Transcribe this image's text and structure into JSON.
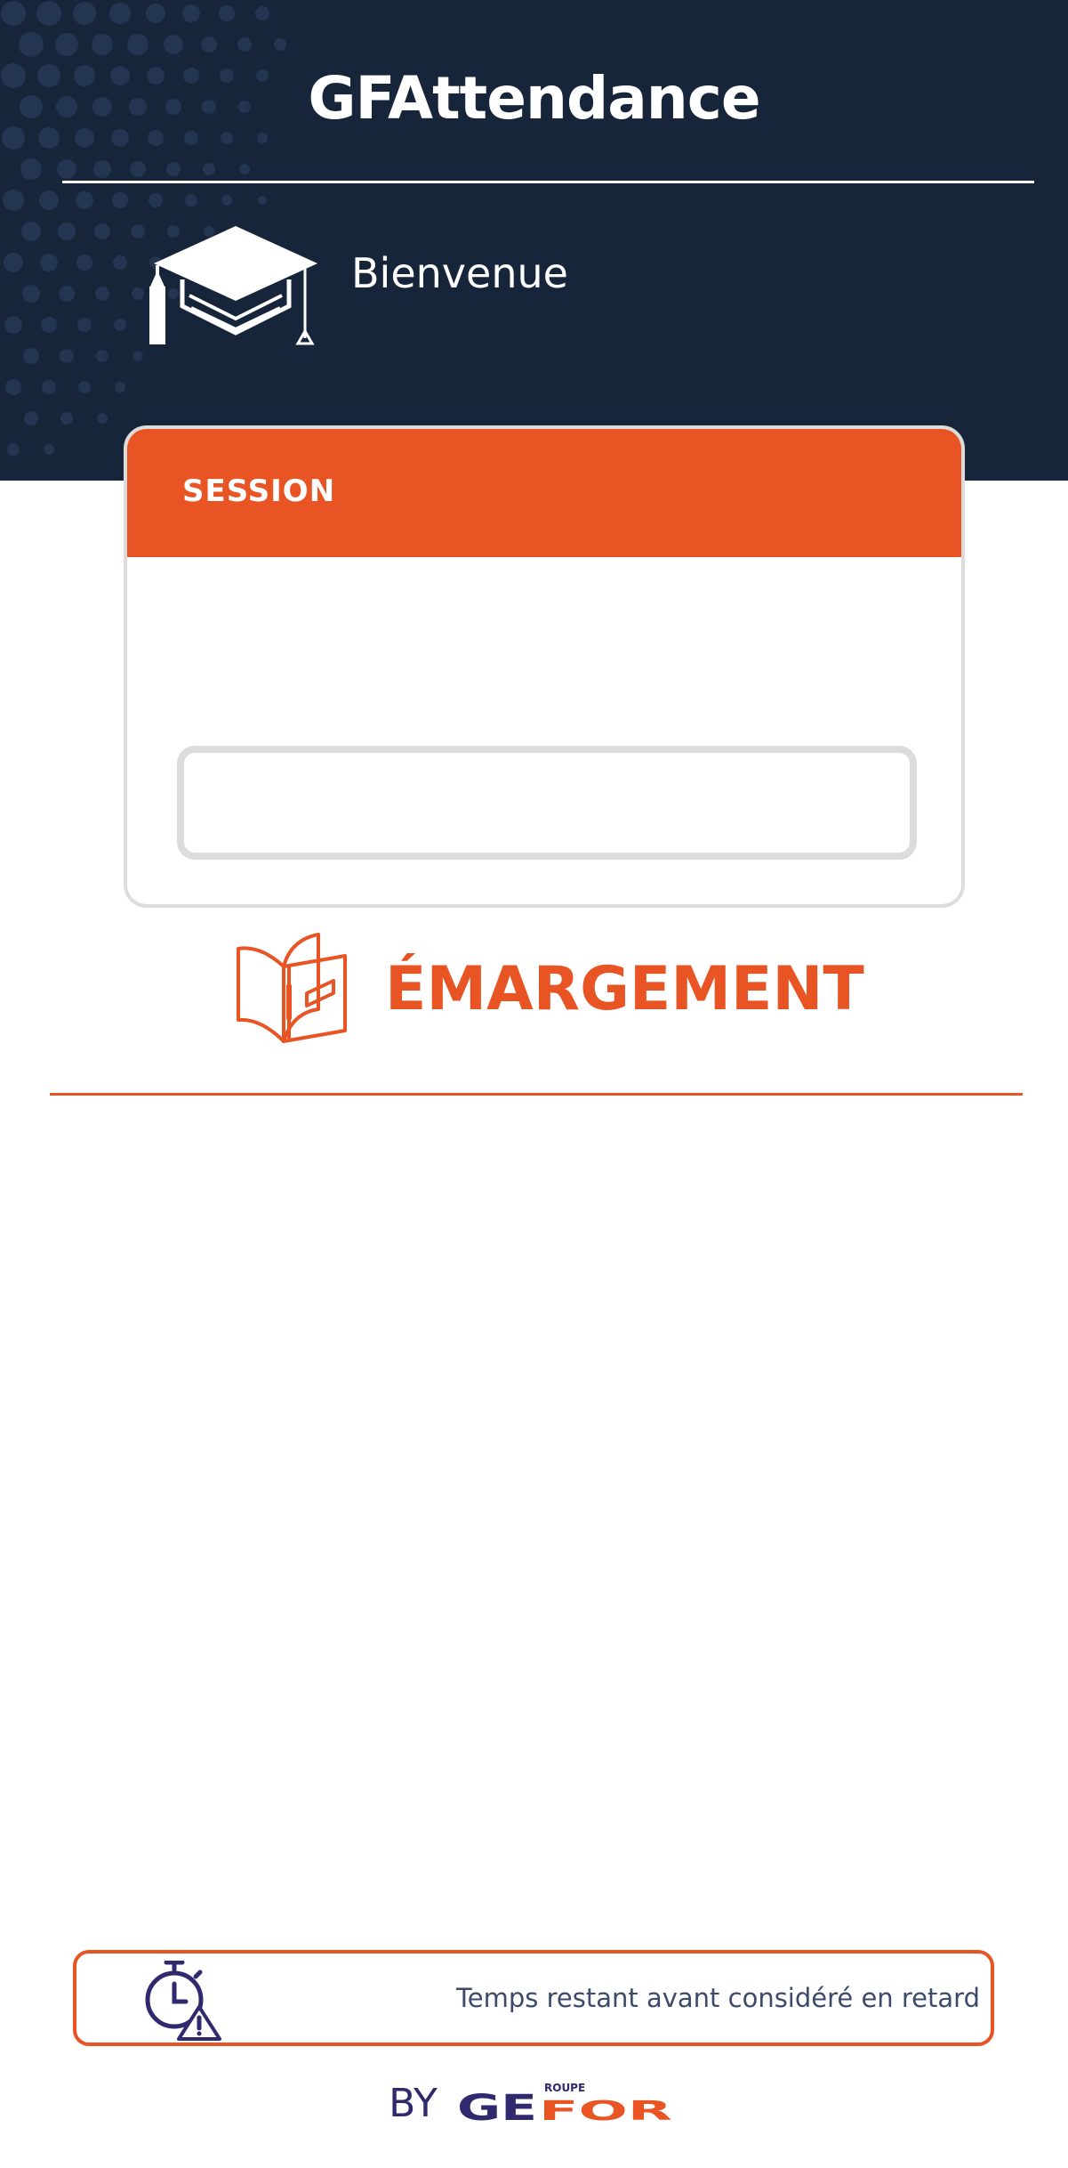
{
  "header": {
    "app_title": "GFAttendance",
    "welcome": "Bienvenue",
    "background_color": "#17253a"
  },
  "session": {
    "label": "SESSION",
    "input_value": "",
    "accent_color": "#e85424"
  },
  "emargement": {
    "label": "ÉMARGEMENT",
    "icon": "open-book-icon"
  },
  "late_banner": {
    "text": "Temps restant avant considéré en retard",
    "icon": "stopwatch-warning-icon"
  },
  "footer": {
    "by_label": "BY",
    "logo_small_text": "ROUPE",
    "logo_main_text_1": "GE",
    "logo_main_text_2": "FOR",
    "logo_primary_color": "#2f2a6e",
    "logo_accent_color": "#e85424"
  }
}
